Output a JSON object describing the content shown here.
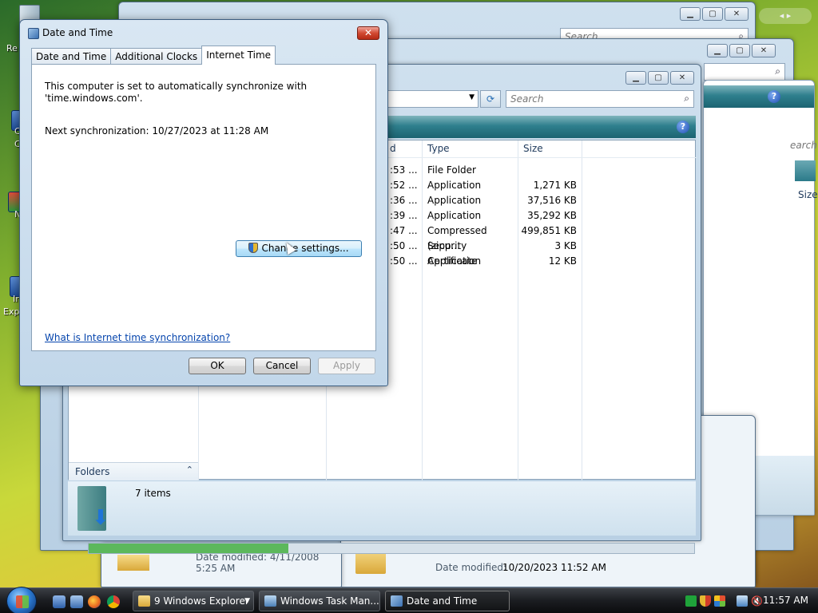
{
  "desktop": {
    "labels": [
      "Re",
      "C",
      "C",
      "N",
      "I",
      "Ir",
      "Expl"
    ]
  },
  "back_windows": {
    "search_placeholder": "Search",
    "search_partial": "earch",
    "size_header": "Size",
    "date_modified_label": "Date modified:",
    "date_modified_value": "10/20/2023 11:52 AM",
    "date_modified_partial": "Date modified: 4/11/2008 5:25 AM"
  },
  "explorer": {
    "search_placeholder": "Search",
    "columns": {
      "date": "d",
      "type": "Type",
      "size": "Size"
    },
    "rows": [
      {
        "date": ":53 ...",
        "type": "File Folder",
        "size": ""
      },
      {
        "date": ":52 ...",
        "type": "Application",
        "size": "1,271 KB"
      },
      {
        "date": ":36 ...",
        "type": "Application",
        "size": "37,516 KB"
      },
      {
        "date": ":39 ...",
        "type": "Application",
        "size": "35,292 KB"
      },
      {
        "date": ":47 ...",
        "type": "Compressed (zipp...",
        "size": "499,851 KB"
      },
      {
        "date": ":50 ...",
        "type": "Security Certificate",
        "size": "3 KB"
      },
      {
        "date": ":50 ...",
        "type": "Application",
        "size": "12 KB"
      }
    ],
    "folders_label": "Folders",
    "item_count": "7 items"
  },
  "dialog": {
    "title": "Date and Time",
    "close_label": "✕",
    "tabs": [
      {
        "label": "Date and Time",
        "active": false
      },
      {
        "label": "Additional Clocks",
        "active": false
      },
      {
        "label": "Internet Time",
        "active": true
      }
    ],
    "sync_line1": "This computer is set to automatically synchronize with",
    "sync_line2": "'time.windows.com'.",
    "next_sync": "Next synchronization: 10/27/2023 at 11:28 AM",
    "change_settings": "Change settings...",
    "help_link": "What is Internet time synchronization?",
    "ok": "OK",
    "cancel": "Cancel",
    "apply": "Apply"
  },
  "taskbar": {
    "buttons": [
      {
        "label": "9 Windows Explorer",
        "count": "9",
        "text": "Windows Explorer",
        "active": false
      },
      {
        "label": "Windows Task Man...",
        "active": false
      },
      {
        "label": "Date and Time",
        "active": true
      }
    ],
    "clock": "11:57 AM"
  },
  "colors": {
    "teal": "#2f7f8d",
    "link": "#0645ad",
    "close_red": "#d24a32",
    "progress_green": "#5cb85c"
  },
  "progress": {
    "fill_fraction": 0.33
  }
}
